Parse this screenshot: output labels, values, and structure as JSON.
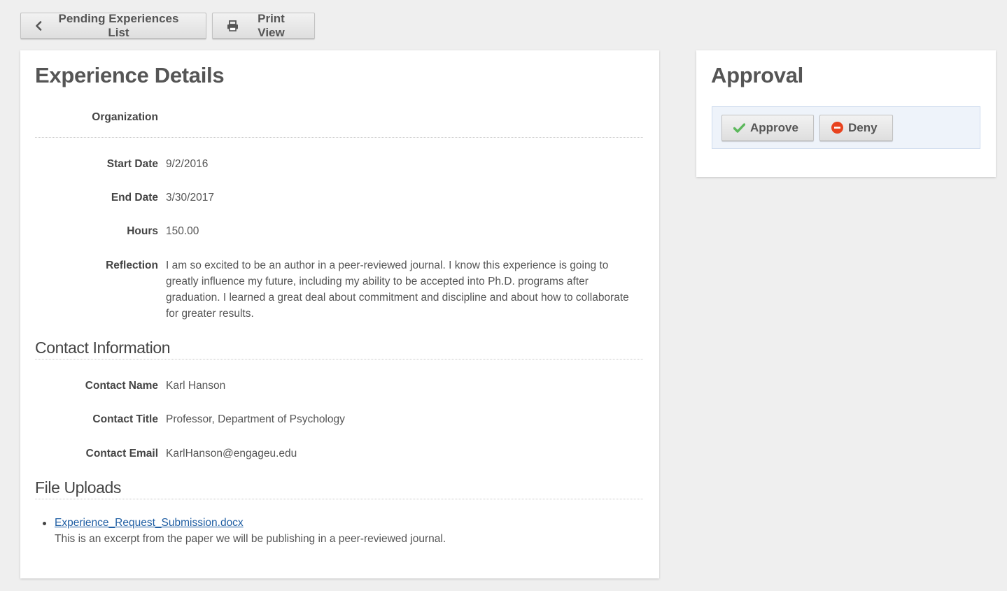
{
  "toolbar": {
    "back_label": "Pending Experiences List",
    "print_label": "Print View"
  },
  "details": {
    "title": "Experience Details",
    "organization_label": "Organization",
    "organization_value": "",
    "start_date_label": "Start Date",
    "start_date_value": "9/2/2016",
    "end_date_label": "End Date",
    "end_date_value": "3/30/2017",
    "hours_label": "Hours",
    "hours_value": "150.00",
    "reflection_label": "Reflection",
    "reflection_value": "I am so excited to be an author in a peer-reviewed journal. I know this experience is going to greatly influence my future, including my ability to be accepted into Ph.D. programs after graduation. I learned a great deal about commitment and discipline and about how to collaborate for greater results."
  },
  "contact": {
    "heading": "Contact Information",
    "name_label": "Contact Name",
    "name_value": "Karl Hanson",
    "title_label": "Contact Title",
    "title_value": "Professor, Department of Psychology",
    "email_label": "Contact Email",
    "email_value": "KarlHanson@engageu.edu"
  },
  "uploads": {
    "heading": "File Uploads",
    "files": [
      {
        "name": "Experience_Request_Submission.docx",
        "description": "This is an excerpt from the paper we will be publishing in a peer-reviewed journal."
      }
    ]
  },
  "approval": {
    "title": "Approval",
    "approve_label": "Approve",
    "deny_label": "Deny"
  },
  "colors": {
    "approve_check": "#5cb85c",
    "deny_icon": "#e8431f",
    "link": "#1f5ea3"
  }
}
